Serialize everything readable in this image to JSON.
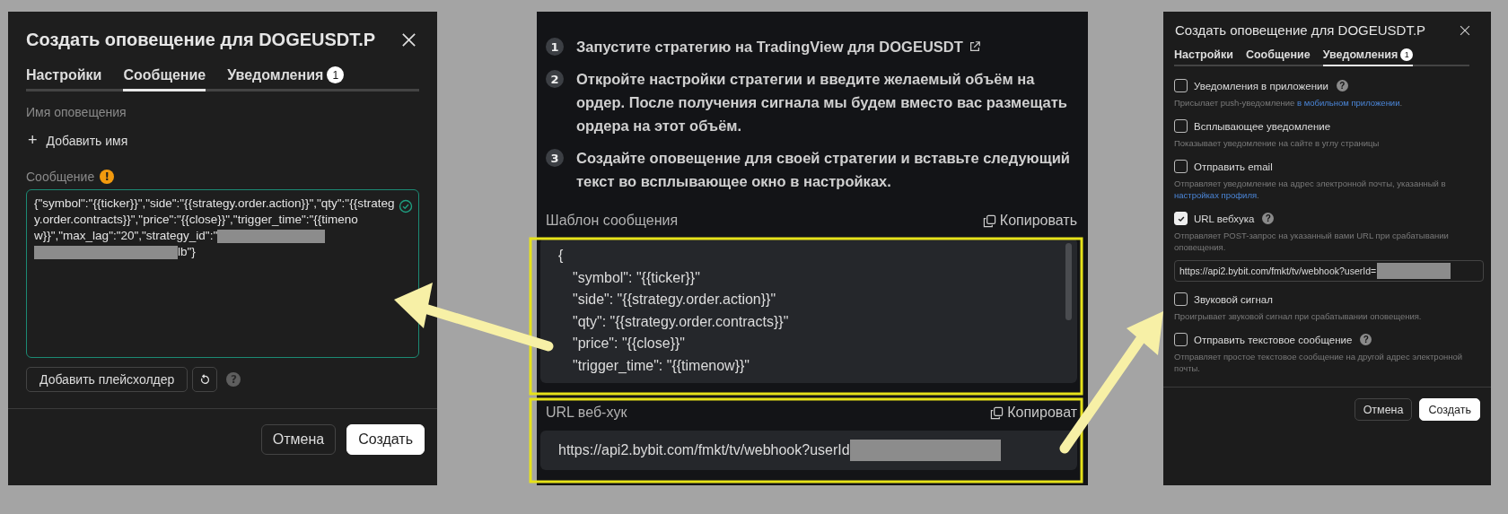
{
  "left_dialog": {
    "title": "Создать оповещение для DOGEUSDT.P",
    "tabs": [
      {
        "label": "Настройки",
        "selected": false
      },
      {
        "label": "Сообщение",
        "selected": true
      },
      {
        "label": "Уведомления",
        "badge": "1",
        "selected": false
      }
    ],
    "name_label": "Имя оповещения",
    "add_name": {
      "icon": "+",
      "label": "Добавить имя"
    },
    "message_label": "Сообщение",
    "warning": "!",
    "message": {
      "text": "{\"symbol\":\"{{ticker}}\",\"side\":\"{{strategy.order.action}}\",\"qty\":\"{{strategy.order.contracts}}\",\"price\":\"{{close}}\",\"trigger_time\":\"{{timenow}}\",\"max_lag\":\"20\",\"strategy_id\":\"",
      "redacted": true,
      "text_end": "lb\"}",
      "valid": true
    },
    "placeholder_button": "Добавить плейсхолдер",
    "help": "?",
    "buttons": [
      {
        "label": "Отмена",
        "kind": "secondary"
      },
      {
        "label": "Создать",
        "kind": "primary"
      }
    ]
  },
  "instructions": {
    "steps": [
      {
        "number": "1",
        "text": "Запустите стратегию на TradingView для DOGEUSDT",
        "external_link": true
      },
      {
        "number": "2",
        "text": "Откройте настройки стратегии и введите желаемый объём на ордер. После получения сигнала мы будем вместо вас размещать ордера на этот объём."
      },
      {
        "number": "3",
        "text": "Создайте оповещение для своей стратегии и вставьте следующий текст во всплывающее окно в настройках."
      }
    ],
    "template": {
      "label": "Шаблон сообщения",
      "copy": "Копировать",
      "lines": [
        {
          "text": "{",
          "kind": "brace"
        },
        {
          "text": "\"symbol\": \"{{ticker}}\"",
          "kind": "entry"
        },
        {
          "text": "\"side\": \"{{strategy.order.action}}\"",
          "kind": "entry"
        },
        {
          "text": "\"qty\": \"{{strategy.order.contracts}}\"",
          "kind": "entry"
        },
        {
          "text": "\"price\": \"{{close}}\"",
          "kind": "entry"
        },
        {
          "text": "\"trigger_time\": \"{{timenow}}\"",
          "kind": "entry"
        }
      ]
    },
    "webhook": {
      "label": "URL веб-хук",
      "copy": "Копироват",
      "url": "https://api2.bybit.com/fmkt/tv/webhook?userId",
      "redacted": true
    }
  },
  "right_dialog": {
    "title": "Создать оповещение для DOGEUSDT.P",
    "tabs": [
      {
        "label": "Настройки",
        "selected": false
      },
      {
        "label": "Сообщение",
        "selected": false
      },
      {
        "label": "Уведомления",
        "badge": "1",
        "selected": true
      }
    ],
    "options": [
      {
        "label": "Уведомления в приложении",
        "checked": false,
        "help": "?",
        "description": "Присылает push-уведомление ",
        "link": "в мобильном приложении",
        "description_end": "."
      },
      {
        "label": "Всплывающее уведомление",
        "checked": false,
        "description": "Показывает уведомление на сайте в углу страницы"
      },
      {
        "label": "Отправить email",
        "checked": false,
        "description": "Отправляет уведомление на адрес электронной почты, указанный в ",
        "link": "настройках профиля",
        "description_end": "."
      },
      {
        "label": "URL вебхука",
        "checked": true,
        "help": "?",
        "description": "Отправляет POST-запрос на указанный вами URL при срабатывании оповещения.",
        "url": "https://api2.bybit.com/fmkt/tv/webhook?userId=",
        "redacted": true
      },
      {
        "label": "Звуковой сигнал",
        "checked": false,
        "description": "Проигрывает звуковой сигнал при срабатывании оповещения."
      },
      {
        "label": "Отправить текстовое сообщение",
        "checked": false,
        "help": "?",
        "description": "Отправляет простое текстовое сообщение на другой адрес электронной почты."
      }
    ],
    "buttons": [
      {
        "label": "Отмена",
        "kind": "secondary"
      },
      {
        "label": "Создать",
        "kind": "primary"
      }
    ]
  }
}
